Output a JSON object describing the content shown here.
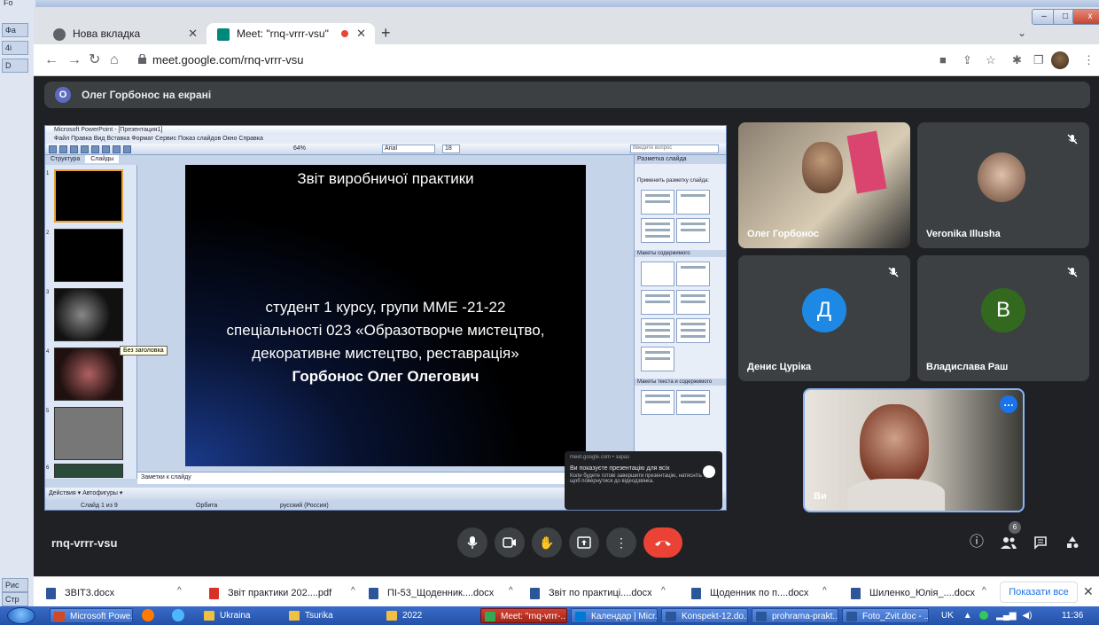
{
  "word": {
    "title": "Fo",
    "side_tabs": [
      "Фа",
      "4i",
      "D"
    ],
    "bottom_tabs": [
      "Рис",
      "Стр"
    ]
  },
  "browser": {
    "tabs": [
      {
        "label": "Нова вкладка",
        "active": false
      },
      {
        "label": "Meet: \"rnq-vrrr-vsu\"",
        "active": true
      }
    ],
    "new_tab": "+",
    "url": "meet.google.com/rnq-vrrr-vsu",
    "window_controls": [
      "–",
      "□",
      "x"
    ]
  },
  "meet": {
    "presenter_initial": "O",
    "presenting_text": "Олег Горбонос на екрані",
    "meeting_code": "rnq-vrrr-vsu",
    "participant_badge": "6",
    "participants": [
      {
        "name": "Олег Горбонос",
        "muted": false
      },
      {
        "name": "Veronika Illusha",
        "muted": true
      },
      {
        "name": "Денис Цуріка",
        "initial": "Д",
        "color": "#1e88e5",
        "muted": true
      },
      {
        "name": "Владислава Раш",
        "initial": "В",
        "color": "#33691e",
        "muted": true
      },
      {
        "name": "Ви",
        "muted": false
      }
    ]
  },
  "powerpoint": {
    "window_title": "Microsoft PowerPoint - [Презентация1]",
    "menu": "Файл  Правка  Вид  Вставка  Формат  Сервис  Показ слайдов  Окно  Справка",
    "help_placeholder": "Введите вопрос",
    "font_name": "Arial",
    "font_size": "18",
    "zoom": "64%",
    "side_tabs": [
      "Структура",
      "Слайды"
    ],
    "tooltip": "Без заголовка",
    "slide": {
      "title": "Звіт виробничої практики",
      "line1": "студент 1 курсу, групи ММЕ -21-22",
      "line2": "спеціальності 023 «Образотворче мистецтво,",
      "line3": "декоративне мистецтво, реставрація»",
      "line4": "Горбонос Олег Олегович"
    },
    "notes_placeholder": "Заметки к слайду",
    "drawbar": "Действия ▾  Автофигуры ▾",
    "status": {
      "slide": "Слайд 1 из 9",
      "theme": "Орбита",
      "lang": "русский (Россия)"
    },
    "layout_pane": {
      "title": "Разметка слайда",
      "apply_label": "Применить разметку слайда:",
      "section_content": "Макеты содержимого",
      "section_text_content": "Макеты текста и содержимого"
    }
  },
  "notification": {
    "source": "meet.google.com • зараз",
    "title": "Ви показуєте презентацію для всіх",
    "body": "Коли будете готові завершити презентацію, натисніть тут, щоб повернутися до відеодзвінка."
  },
  "downloads": {
    "items": [
      {
        "label": "ЗВІТ3.docx",
        "type": "doc"
      },
      {
        "label": "Звіт практики 202....pdf",
        "type": "pdf"
      },
      {
        "label": "ПІ-53_Щоденник....docx",
        "type": "doc"
      },
      {
        "label": "Звіт по практиці....docx",
        "type": "doc"
      },
      {
        "label": "Щоденник по п....docx",
        "type": "doc"
      },
      {
        "label": "Шиленко_Юлія_....docx",
        "type": "doc"
      }
    ],
    "show_all": "Показати все",
    "close": "✕"
  },
  "taskbar": {
    "apps": [
      {
        "label": "Microsoft Powe...",
        "style": "btn"
      },
      {
        "label": "Ukraina",
        "style": "plain"
      },
      {
        "label": "Tsurika",
        "style": "plain"
      },
      {
        "label": "2022",
        "style": "plain"
      },
      {
        "label": "Meet: \"rnq-vrrr-...",
        "style": "active"
      },
      {
        "label": "Календар | Micr...",
        "style": "btn"
      },
      {
        "label": "Konspekt-12.do...",
        "style": "btn"
      },
      {
        "label": "prohrama-prakt...",
        "style": "btn"
      },
      {
        "label": "Foto_Zvit.doc - ...",
        "style": "btn"
      }
    ],
    "lang": "UK",
    "time": "11:36"
  },
  "colors": {
    "meet_bg": "#202124",
    "hangup": "#ea4335",
    "accent": "#1a73e8"
  }
}
